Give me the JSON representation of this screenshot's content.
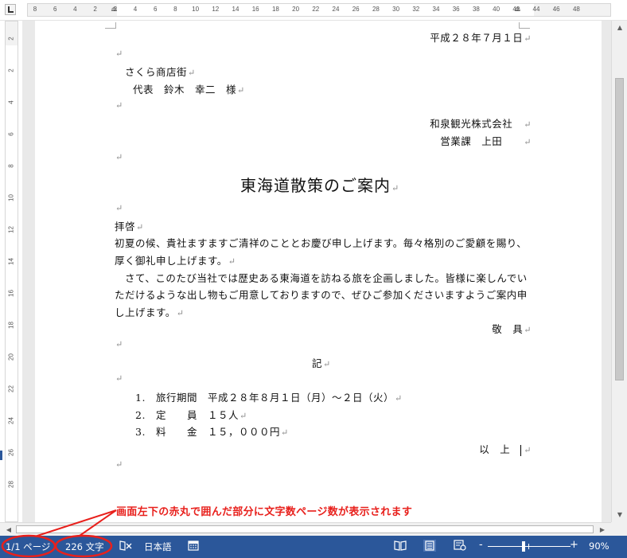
{
  "ruler": {
    "top_ticks": [
      "8",
      "6",
      "4",
      "2",
      "2",
      "4",
      "6",
      "8",
      "10",
      "12",
      "14",
      "16",
      "18",
      "20",
      "22",
      "24",
      "26",
      "28",
      "30",
      "32",
      "34",
      "36",
      "38",
      "40",
      "42",
      "44",
      "46",
      "48"
    ],
    "left_ticks": [
      "2",
      "2",
      "4",
      "6",
      "8",
      "10",
      "12",
      "14",
      "16",
      "18",
      "20",
      "22",
      "24",
      "26",
      "28"
    ]
  },
  "document": {
    "date": "平成２８年７月１日",
    "recipient_company": "さくら商店街",
    "recipient_name": "代表　鈴木　幸二　様",
    "sender_company": "和泉観光株式会社",
    "sender_dept": "営業課　上田",
    "title": "東海道散策のご案内",
    "salutation": "拝啓",
    "body_line1": "初夏の候、貴社ますますご清祥のこととお慶び申し上げます。毎々格別のご愛顧を賜り、",
    "body_line2": "厚く御礼申し上げます。",
    "body_line3": "　さて、このたび当社では歴史ある東海道を訪ねる旅を企画しました。皆様に楽しんでい",
    "body_line4": "ただけるような出し物もご用意しておりますので、ぜひご参加くださいますようご案内申",
    "body_line5": "し上げます。",
    "closing": "敬　具",
    "ki": "記",
    "items": [
      {
        "num": "1.",
        "text": "旅行期間　平成２８年８月１日（月）～２日（火）"
      },
      {
        "num": "2.",
        "text": "定　　員　１５人"
      },
      {
        "num": "3.",
        "text": "料　　金　１５，０００円"
      }
    ],
    "end": "以　上",
    "paragraph_mark": "↵"
  },
  "annotation": {
    "text": "画面左下の赤丸で囲んだ部分に文字数ページ数が表示されます",
    "color": "#e8201c"
  },
  "statusbar": {
    "page_count": "1/1 ページ",
    "word_count": "226 文字",
    "language": "日本語",
    "zoom_minus": "-",
    "zoom_plus": "+",
    "zoom_level": "90%",
    "background": "#2b579a"
  }
}
